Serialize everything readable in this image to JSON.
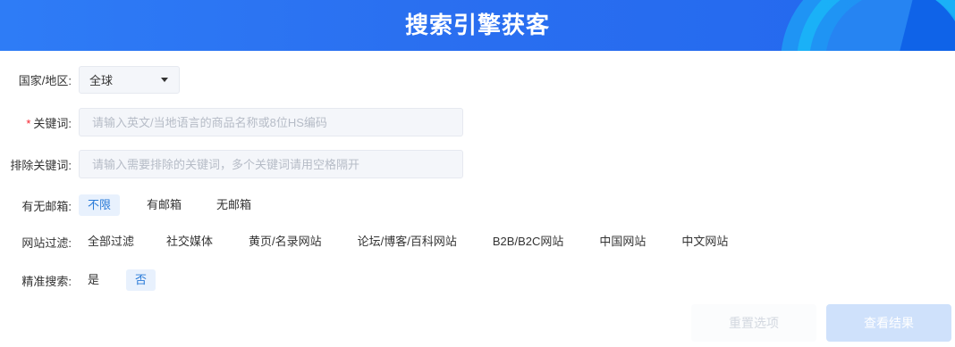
{
  "banner": {
    "title": "搜索引擎获客"
  },
  "form": {
    "country": {
      "label": "国家/地区:",
      "value": "全球",
      "icon": "caret-down-icon"
    },
    "keyword": {
      "required_mark": "*",
      "label": "关键词:",
      "placeholder": "请输入英文/当地语言的商品名称或8位HS编码",
      "value": ""
    },
    "exclude": {
      "label": "排除关键词:",
      "placeholder": "请输入需要排除的关键词，多个关键词请用空格隔开",
      "value": ""
    },
    "mailbox": {
      "label": "有无邮箱:",
      "options": [
        "不限",
        "有邮箱",
        "无邮箱"
      ],
      "selected": "不限"
    },
    "site_filter": {
      "label": "网站过滤:",
      "options": [
        "全部过滤",
        "社交媒体",
        "黄页/名录网站",
        "论坛/博客/百科网站",
        "B2B/B2C网站",
        "中国网站",
        "中文网站"
      ]
    },
    "precise": {
      "label": "精准搜索:",
      "options": [
        "是",
        "否"
      ],
      "selected": "否"
    }
  },
  "actions": {
    "reset_label": "重置选项",
    "search_label": "查看结果"
  },
  "colors": {
    "banner": "#2a6ff0",
    "accent": "#2a7bd8",
    "active_bg": "#e8f1fd",
    "required": "#f5222d",
    "search_button_bg": "#cfe1fb"
  }
}
